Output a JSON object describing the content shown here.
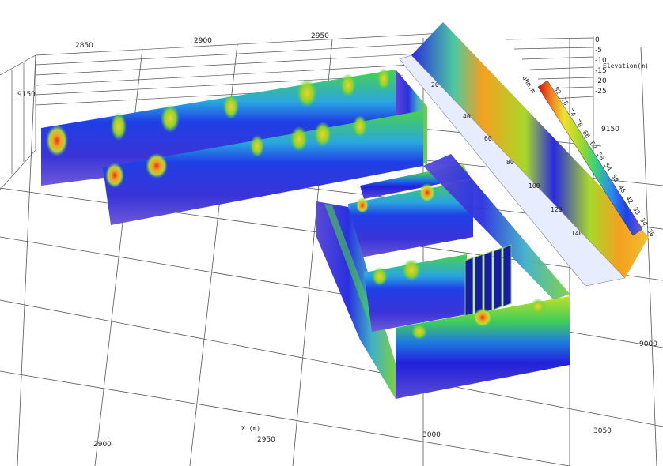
{
  "chart_data": {
    "type": "heatmap",
    "title": "",
    "x_axis": {
      "label": "X (m)",
      "top_ticks": [
        "2850",
        "2900",
        "2950"
      ],
      "bottom_ticks": [
        "2900",
        "2950",
        "3000",
        "3050"
      ]
    },
    "y_axis": {
      "label": "",
      "ticks": [
        "9150",
        "9000"
      ]
    },
    "z_axis": {
      "label": "Elevation(m)",
      "ticks": [
        "0",
        "-5",
        "-10",
        "-15",
        "-20",
        "-25"
      ]
    },
    "colorbar": {
      "unit": "ohm.m",
      "labels": [
        "30",
        "34",
        "38",
        "42",
        "46",
        "50",
        "54",
        "58",
        "62",
        "66",
        "70",
        "74",
        "78",
        "82"
      ],
      "colors": [
        "#5a3fd0",
        "#2a2ae0",
        "#1f4ff0",
        "#2b8cf0",
        "#3fd0e0",
        "#39d27a",
        "#4cc92a",
        "#8fd32a",
        "#d4e02a",
        "#f2e030",
        "#f5b02a",
        "#f07a20",
        "#e83a18",
        "#d40f0f"
      ]
    },
    "profile_labels": [
      "20",
      "40",
      "60",
      "80",
      "100",
      "120",
      "140"
    ],
    "data_note": ""
  },
  "colors": {
    "low": "#2020d8",
    "mid": "#39d27a",
    "high": "#e0301a",
    "grid": "#555555"
  }
}
